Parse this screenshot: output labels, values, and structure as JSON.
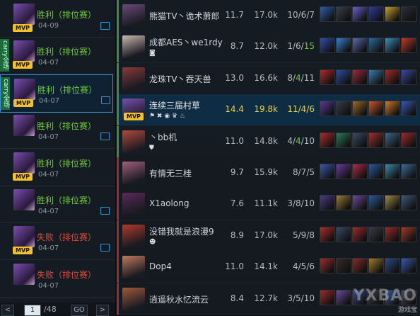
{
  "matches": [
    {
      "result": "胜利（排位赛）",
      "outcome": "win",
      "date": "04-09",
      "carry": "",
      "mvp": true,
      "selected": false,
      "color": "#7a4fb0"
    },
    {
      "result": "胜利（排位赛）",
      "outcome": "win",
      "date": "04-07",
      "carry": "carry全场",
      "mvp": true,
      "selected": false,
      "color": "#7a4fb0"
    },
    {
      "result": "胜利（排位赛）",
      "outcome": "win",
      "date": "04-07",
      "carry": "carry全场",
      "mvp": true,
      "selected": true,
      "color": "#7a4fb0"
    },
    {
      "result": "胜利（排位赛）",
      "outcome": "win",
      "date": "04-07",
      "carry": "",
      "mvp": false,
      "selected": false,
      "color": "#7a4fb0"
    },
    {
      "result": "胜利（排位赛）",
      "outcome": "win",
      "date": "04-07",
      "carry": "",
      "mvp": true,
      "selected": false,
      "color": "#7a4fb0"
    },
    {
      "result": "胜利（排位赛）",
      "outcome": "win",
      "date": "04-07",
      "carry": "",
      "mvp": false,
      "selected": false,
      "color": "#7a4fb0"
    },
    {
      "result": "失败（排位赛）",
      "outcome": "loss",
      "date": "04-07",
      "carry": "",
      "mvp": true,
      "selected": false,
      "color": "#7a4fb0"
    },
    {
      "result": "失败（排位赛）",
      "outcome": "loss",
      "date": "04-07",
      "carry": "",
      "mvp": false,
      "selected": false,
      "color": "#7a4fb0"
    }
  ],
  "pager": {
    "prev": "<",
    "page": "1",
    "total": "/48",
    "go": "GO",
    "next": ">"
  },
  "players": [
    {
      "name": "熊猫TV丶诡术萧郎",
      "score": "11.7",
      "gold": "17.0k",
      "kda": [
        "10",
        "6",
        "7"
      ],
      "kda_hl": [],
      "team": "blue",
      "me": false,
      "avatar": "#6b4a7a",
      "items": [
        "#2a5fb0",
        "#3a3f48",
        "#6a5fd0",
        "#2f3a9a",
        "#c8a030",
        "#2a2f38"
      ]
    },
    {
      "name": "成都AES丶we1rdy",
      "score": "8.7",
      "gold": "12.0k",
      "kda": [
        "1",
        "6",
        "15"
      ],
      "kda_hl": [
        2
      ],
      "team": "blue",
      "me": false,
      "avatar": "#c9b8b0",
      "items": [
        "#2f4fb0",
        "#3a7fd0",
        "#5a6ab0",
        "#2a6a9a",
        "#3a90c0",
        "#c03a2a"
      ]
    },
    {
      "name": "龙珠TV丶吞天兽",
      "score": "13.0",
      "gold": "16.6k",
      "kda": [
        "8",
        "4",
        "11"
      ],
      "kda_hl": [
        1
      ],
      "team": "blue",
      "me": false,
      "avatar": "#8a3a3a",
      "items": [
        "#b02a2a",
        "#2a4fa0",
        "#9a2a3a",
        "#3a7ab0",
        "#a02a2a",
        "#3a4a9a"
      ]
    },
    {
      "name": "连续三届村草",
      "score": "14.4",
      "gold": "19.8k",
      "kda": [
        "11",
        "4",
        "6"
      ],
      "kda_hl": [],
      "team": "blue",
      "me": true,
      "avatar": "#7a4fb0",
      "items": [
        "#5a3a9a",
        "#3a3a4a",
        "#9a6a2a",
        "#c8562a",
        "#d07a2a",
        "#3a5ab0"
      ]
    },
    {
      "name": "丶bb机",
      "score": "11.0",
      "gold": "14.8k",
      "kda": [
        "4",
        "4",
        "10"
      ],
      "kda_hl": [
        1
      ],
      "team": "blue",
      "me": false,
      "avatar": "#b04a3a",
      "items": [
        "#b02a2a",
        "#2a7a5a",
        "#3a4a6a",
        "#a0302a",
        "#3a6a8a",
        "#9a2a2a"
      ]
    },
    {
      "name": "有情无三桂",
      "score": "9.7",
      "gold": "15.9k",
      "kda": [
        "8",
        "7",
        "5"
      ],
      "kda_hl": [],
      "team": "red",
      "me": false,
      "avatar": "#a0607a",
      "items": [
        "#3a5ab0",
        "#6a3a9a",
        "#b02a4a",
        "#2a5a9a",
        "#3a8ab0",
        "#3a6a9a"
      ]
    },
    {
      "name": "X1aolong",
      "score": "7.6",
      "gold": "11.1k",
      "kda": [
        "3",
        "8",
        "10"
      ],
      "kda_hl": [],
      "team": "red",
      "me": false,
      "avatar": "#5a2a5a",
      "items": [
        "#4a3a8a",
        "#9a7a3a",
        "#6a4a9a",
        "#2a5a9a",
        "#a08a4a",
        "#3a5a7a"
      ]
    },
    {
      "name": "没错我就是浪漫9",
      "score": "8.9",
      "gold": "17.0k",
      "kda": [
        "5",
        "9",
        "8"
      ],
      "kda_hl": [],
      "team": "red",
      "me": false,
      "avatar": "#b03a2a",
      "items": [
        "#b02a2a",
        "#3a4a6a",
        "#a02a2a",
        "#3a3a4a",
        "#9a2a2a",
        "#a03a2a"
      ]
    },
    {
      "name": "Dop4",
      "score": "11.0",
      "gold": "14.1k",
      "kda": [
        "4",
        "5",
        "6"
      ],
      "kda_hl": [],
      "team": "red",
      "me": false,
      "avatar": "#c07a5a",
      "items": [
        "#a02a2a",
        "#3a2a2a",
        "#8a2a2a",
        "#a07a2a",
        "#2a4a8a",
        "#3a5ab0"
      ]
    },
    {
      "name": "逍遥秋水忆流云",
      "score": "8.4",
      "gold": "12.7k",
      "kda": [
        "3",
        "5",
        "10"
      ],
      "kda_hl": [],
      "team": "red",
      "me": false,
      "avatar": "#a05a3a",
      "items": [
        "#a02a2a",
        "#6a4a9a",
        "#3a4a8a",
        "#3a3a4a",
        "#3a5a9a",
        "#4a4a5a"
      ]
    }
  ],
  "me_badges": "⚑ ✖ ◉ ♛ ♨",
  "bb_badge": "⛊",
  "we1rdy_badge": "◙",
  "langman_badge": "☻",
  "watermark": {
    "big": "YXBAO",
    "small": "游戏宝"
  },
  "colors": {
    "win": "#6fc83a",
    "loss": "#e04a3a",
    "blue_side": "#3a8f3a",
    "red_side": "#a02a2a",
    "me_score": "#e8d24a"
  }
}
